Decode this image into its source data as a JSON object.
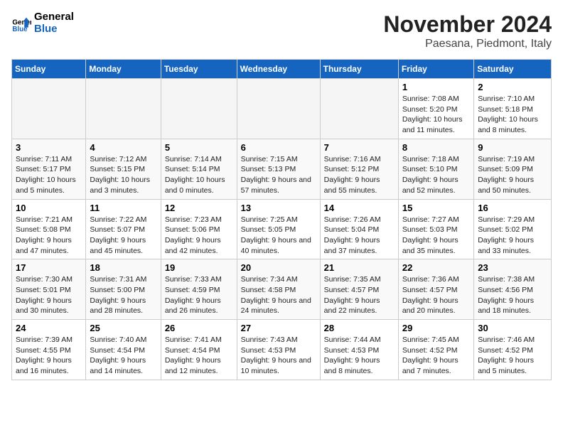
{
  "header": {
    "logo_line1": "General",
    "logo_line2": "Blue",
    "month": "November 2024",
    "location": "Paesana, Piedmont, Italy"
  },
  "weekdays": [
    "Sunday",
    "Monday",
    "Tuesday",
    "Wednesday",
    "Thursday",
    "Friday",
    "Saturday"
  ],
  "weeks": [
    [
      {
        "day": "",
        "info": ""
      },
      {
        "day": "",
        "info": ""
      },
      {
        "day": "",
        "info": ""
      },
      {
        "day": "",
        "info": ""
      },
      {
        "day": "",
        "info": ""
      },
      {
        "day": "1",
        "info": "Sunrise: 7:08 AM\nSunset: 5:20 PM\nDaylight: 10 hours and 11 minutes."
      },
      {
        "day": "2",
        "info": "Sunrise: 7:10 AM\nSunset: 5:18 PM\nDaylight: 10 hours and 8 minutes."
      }
    ],
    [
      {
        "day": "3",
        "info": "Sunrise: 7:11 AM\nSunset: 5:17 PM\nDaylight: 10 hours and 5 minutes."
      },
      {
        "day": "4",
        "info": "Sunrise: 7:12 AM\nSunset: 5:15 PM\nDaylight: 10 hours and 3 minutes."
      },
      {
        "day": "5",
        "info": "Sunrise: 7:14 AM\nSunset: 5:14 PM\nDaylight: 10 hours and 0 minutes."
      },
      {
        "day": "6",
        "info": "Sunrise: 7:15 AM\nSunset: 5:13 PM\nDaylight: 9 hours and 57 minutes."
      },
      {
        "day": "7",
        "info": "Sunrise: 7:16 AM\nSunset: 5:12 PM\nDaylight: 9 hours and 55 minutes."
      },
      {
        "day": "8",
        "info": "Sunrise: 7:18 AM\nSunset: 5:10 PM\nDaylight: 9 hours and 52 minutes."
      },
      {
        "day": "9",
        "info": "Sunrise: 7:19 AM\nSunset: 5:09 PM\nDaylight: 9 hours and 50 minutes."
      }
    ],
    [
      {
        "day": "10",
        "info": "Sunrise: 7:21 AM\nSunset: 5:08 PM\nDaylight: 9 hours and 47 minutes."
      },
      {
        "day": "11",
        "info": "Sunrise: 7:22 AM\nSunset: 5:07 PM\nDaylight: 9 hours and 45 minutes."
      },
      {
        "day": "12",
        "info": "Sunrise: 7:23 AM\nSunset: 5:06 PM\nDaylight: 9 hours and 42 minutes."
      },
      {
        "day": "13",
        "info": "Sunrise: 7:25 AM\nSunset: 5:05 PM\nDaylight: 9 hours and 40 minutes."
      },
      {
        "day": "14",
        "info": "Sunrise: 7:26 AM\nSunset: 5:04 PM\nDaylight: 9 hours and 37 minutes."
      },
      {
        "day": "15",
        "info": "Sunrise: 7:27 AM\nSunset: 5:03 PM\nDaylight: 9 hours and 35 minutes."
      },
      {
        "day": "16",
        "info": "Sunrise: 7:29 AM\nSunset: 5:02 PM\nDaylight: 9 hours and 33 minutes."
      }
    ],
    [
      {
        "day": "17",
        "info": "Sunrise: 7:30 AM\nSunset: 5:01 PM\nDaylight: 9 hours and 30 minutes."
      },
      {
        "day": "18",
        "info": "Sunrise: 7:31 AM\nSunset: 5:00 PM\nDaylight: 9 hours and 28 minutes."
      },
      {
        "day": "19",
        "info": "Sunrise: 7:33 AM\nSunset: 4:59 PM\nDaylight: 9 hours and 26 minutes."
      },
      {
        "day": "20",
        "info": "Sunrise: 7:34 AM\nSunset: 4:58 PM\nDaylight: 9 hours and 24 minutes."
      },
      {
        "day": "21",
        "info": "Sunrise: 7:35 AM\nSunset: 4:57 PM\nDaylight: 9 hours and 22 minutes."
      },
      {
        "day": "22",
        "info": "Sunrise: 7:36 AM\nSunset: 4:57 PM\nDaylight: 9 hours and 20 minutes."
      },
      {
        "day": "23",
        "info": "Sunrise: 7:38 AM\nSunset: 4:56 PM\nDaylight: 9 hours and 18 minutes."
      }
    ],
    [
      {
        "day": "24",
        "info": "Sunrise: 7:39 AM\nSunset: 4:55 PM\nDaylight: 9 hours and 16 minutes."
      },
      {
        "day": "25",
        "info": "Sunrise: 7:40 AM\nSunset: 4:54 PM\nDaylight: 9 hours and 14 minutes."
      },
      {
        "day": "26",
        "info": "Sunrise: 7:41 AM\nSunset: 4:54 PM\nDaylight: 9 hours and 12 minutes."
      },
      {
        "day": "27",
        "info": "Sunrise: 7:43 AM\nSunset: 4:53 PM\nDaylight: 9 hours and 10 minutes."
      },
      {
        "day": "28",
        "info": "Sunrise: 7:44 AM\nSunset: 4:53 PM\nDaylight: 9 hours and 8 minutes."
      },
      {
        "day": "29",
        "info": "Sunrise: 7:45 AM\nSunset: 4:52 PM\nDaylight: 9 hours and 7 minutes."
      },
      {
        "day": "30",
        "info": "Sunrise: 7:46 AM\nSunset: 4:52 PM\nDaylight: 9 hours and 5 minutes."
      }
    ]
  ]
}
